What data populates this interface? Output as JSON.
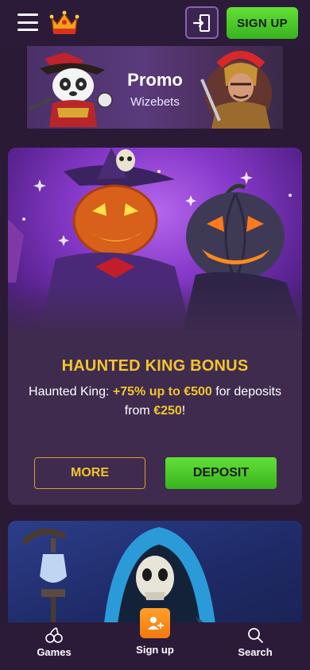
{
  "header": {
    "menu_icon": "hamburger-menu-icon",
    "logo_icon": "crown-logo-icon",
    "login_icon": "login-door-icon",
    "signup_label": "SIGN UP",
    "colors": {
      "signup_green": "#4cc82a",
      "background": "#2b1a38"
    }
  },
  "banner": {
    "title": "Promo",
    "subtitle": "Wizebets"
  },
  "bonus_card": {
    "title": "HAUNTED KING BONUS",
    "desc_prefix": "Haunted King: ",
    "desc_highlight1": "+75% up to €500",
    "desc_middle": " for deposits from ",
    "desc_highlight2": "€250",
    "desc_suffix": "!",
    "more_label": "MORE",
    "deposit_label": "DEPOSIT",
    "colors": {
      "title_gold": "#f3c52c",
      "card_bg": "#3f2b4e"
    }
  },
  "bottom_nav": {
    "items": [
      {
        "label": "Games",
        "icon": "cherries-icon"
      },
      {
        "label": "Sign up",
        "icon": "add-user-icon"
      },
      {
        "label": "Search",
        "icon": "search-icon"
      }
    ],
    "colors": {
      "signup_orange": "#f58a1a"
    }
  }
}
